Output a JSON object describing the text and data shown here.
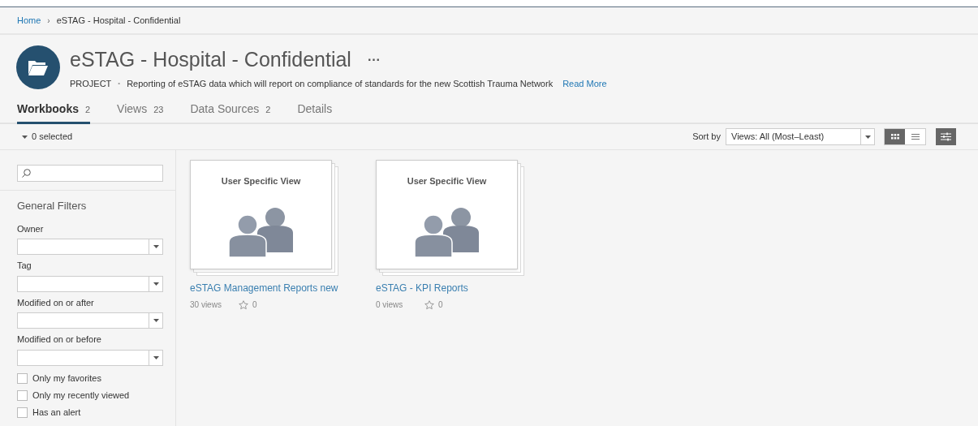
{
  "breadcrumb": [
    {
      "label": "Home",
      "kind": "link"
    },
    {
      "label": "eSTAG - Hospital - Confidential",
      "kind": "current"
    }
  ],
  "breadcrumb_separator": "›",
  "header": {
    "title": "eSTAG - Hospital - Confidential",
    "more": "···",
    "type": "PROJECT",
    "separator": "•",
    "description": "Reporting of eSTAG data which will report on compliance of standards for the new Scottish Trauma Network",
    "read_more": "Read More"
  },
  "tabs": [
    {
      "label": "Workbooks",
      "count": "2",
      "selected": true
    },
    {
      "label": "Views",
      "count": "23",
      "selected": false
    },
    {
      "label": "Data Sources",
      "count": "2",
      "selected": false
    },
    {
      "label": "Details",
      "selected": false
    }
  ],
  "toolbar": {
    "selection": "0 selected",
    "sort_label": "Sort by",
    "sort_value": "Views: All (Most–Least)",
    "view_modes": [
      {
        "kind": "grid",
        "selected": true
      },
      {
        "kind": "list",
        "selected": false
      }
    ]
  },
  "filters": {
    "title": "General Filters",
    "dropdowns": [
      {
        "label": "Owner"
      },
      {
        "label": "Tag"
      },
      {
        "label": "Modified on or after"
      },
      {
        "label": "Modified on or before"
      }
    ],
    "checkboxes": [
      {
        "label": "Only my favorites",
        "checked": false
      },
      {
        "label": "Only my recently viewed",
        "checked": false
      },
      {
        "label": "Has an alert",
        "checked": false
      }
    ]
  },
  "workbooks": [
    {
      "thumbnail_title": "User Specific View",
      "name": "eSTAG Management Reports new",
      "views": "30 views",
      "favorites": "0"
    },
    {
      "thumbnail_title": "User Specific View",
      "name": "eSTAG - KPI Reports",
      "views": "0 views",
      "favorites": "0"
    }
  ]
}
